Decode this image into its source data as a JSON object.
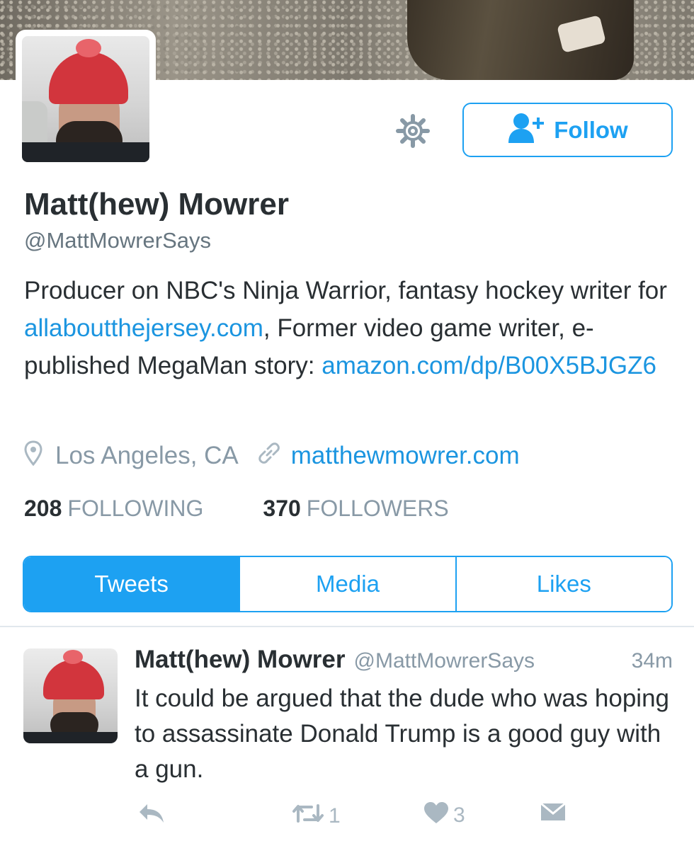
{
  "profile": {
    "name": "Matt(hew) Mowrer",
    "handle": "@MattMowrerSays",
    "bio_parts": {
      "p1": "Producer on NBC's Ninja Warrior, fantasy hockey writer for ",
      "link1": "allaboutthejersey.com",
      "p2": ", Former video game writer, e-published MegaMan story: ",
      "link2": "amazon.com/dp/B00X5BJGZ6"
    },
    "location": "Los Angeles, CA",
    "website": "matthewmowrer.com",
    "following_count": "208",
    "following_label": "FOLLOWING",
    "followers_count": "370",
    "followers_label": "FOLLOWERS"
  },
  "header": {
    "follow_label": "Follow",
    "settings_icon": "gear-icon",
    "follow_icon": "add-user-icon"
  },
  "tabs": [
    {
      "label": "Tweets",
      "active": true
    },
    {
      "label": "Media",
      "active": false
    },
    {
      "label": "Likes",
      "active": false
    }
  ],
  "tweet": {
    "name": "Matt(hew) Mowrer",
    "handle": "@MattMowrerSays",
    "time": "34m",
    "text": "It could be argued that the dude who was hoping to assassinate Donald Trump is a good guy with a gun.",
    "retweets": "1",
    "likes": "3"
  },
  "colors": {
    "accent": "#1da1f2",
    "link": "#1b95e0",
    "muted": "#8899a6",
    "text": "#292f33"
  }
}
